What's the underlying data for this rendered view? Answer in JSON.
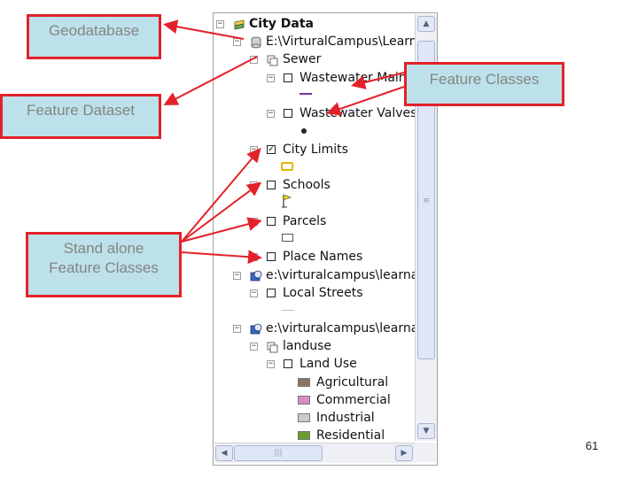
{
  "tree": {
    "root_label": "City Data",
    "geodatabase_path": "E:\\VirturalCampus\\LearnA",
    "dataset_label": "Sewer",
    "wastewater_mains_label": "Wastewater Mains",
    "wastewater_valves_label": "Wastewater Valves",
    "city_limits_label": "City Limits",
    "schools_label": "Schools",
    "parcels_label": "Parcels",
    "place_names_label": "Place Names",
    "local_streets_path": "e:\\virturalcampus\\learnarc",
    "local_streets_label": "Local Streets",
    "landuse_path": "e:\\virturalcampus\\learnarc",
    "landuse_dataset_label": "landuse",
    "land_use_label": "Land Use",
    "legend": [
      {
        "label": "Agricultural",
        "color": "#8b7560"
      },
      {
        "label": "Commercial",
        "color": "#d58fbf"
      },
      {
        "label": "Industrial",
        "color": "#cccccc"
      },
      {
        "label": "Residential",
        "color": "#6a9c2e"
      }
    ]
  },
  "callouts": {
    "geodatabase": "Geodatabase",
    "feature_dataset": "Feature Dataset",
    "feature_classes": "Feature Classes",
    "standalone_line1": "Stand alone",
    "standalone_line2": "Feature Classes"
  },
  "colors": {
    "callout_fill": "#bde1ea",
    "callout_border": "#e3212a",
    "arrow": "#e3212a",
    "mains_line": "#7a2f9a",
    "city_limits": "#e8b400"
  },
  "page_number": "61"
}
